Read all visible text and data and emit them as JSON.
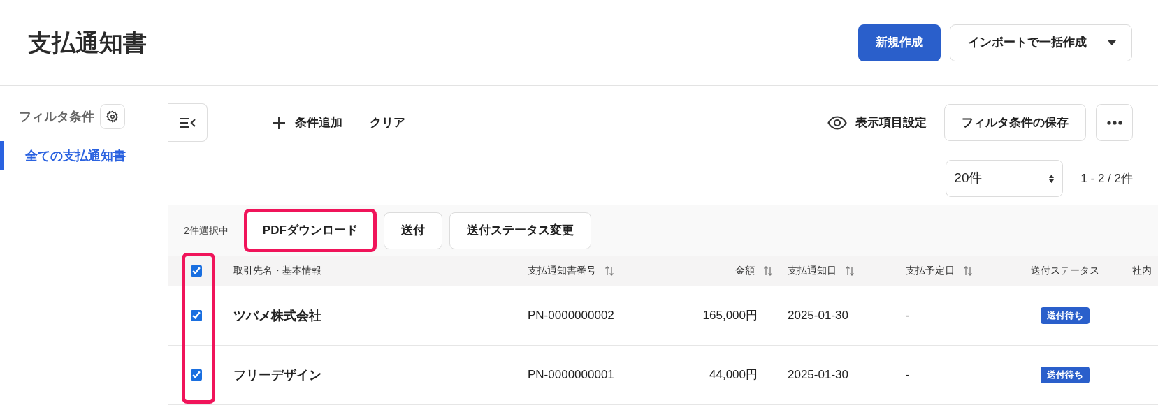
{
  "page": {
    "title": "支払通知書"
  },
  "header_actions": [
    {
      "kind": "primary",
      "label": "新規作成"
    },
    {
      "kind": "dropdown",
      "label": "インポートで一括作成"
    }
  ],
  "sidebar": {
    "heading": "フィルタ条件",
    "items": [
      {
        "label": "全ての支払通知書",
        "selected": true
      }
    ]
  },
  "toolbar": {
    "add_condition": "条件追加",
    "clear": "クリア",
    "display_settings": "表示項目設定",
    "save_filter": "フィルタ条件の保存"
  },
  "pagination": {
    "per_page": "20件",
    "range": "1 - 2 / 2件"
  },
  "bulk_bar": {
    "selected_count": "2件選択中",
    "actions": [
      {
        "label": "PDFダウンロード",
        "highlighted": true
      },
      {
        "label": "送付",
        "highlighted": false
      },
      {
        "label": "送付ステータス変更",
        "highlighted": false
      }
    ]
  },
  "table": {
    "all_checked": true,
    "checkbox_column_highlighted": true,
    "columns": [
      {
        "label": "取引先名・基本情報",
        "sortable": false
      },
      {
        "label": "支払通知書番号",
        "sortable": true
      },
      {
        "label": "金額",
        "sortable": true
      },
      {
        "label": "支払通知日",
        "sortable": true
      },
      {
        "label": "支払予定日",
        "sortable": true
      },
      {
        "label": "送付ステータス",
        "sortable": false
      },
      {
        "label": "社内",
        "sortable": false
      }
    ],
    "rows": [
      {
        "checked": true,
        "partner": "ツバメ株式会社",
        "number": "PN-0000000002",
        "amount": "165,000円",
        "notice_date": "2025-01-30",
        "scheduled_date": "-",
        "status": "送付待ち"
      },
      {
        "checked": true,
        "partner": "フリーデザイン",
        "number": "PN-0000000001",
        "amount": "44,000円",
        "notice_date": "2025-01-30",
        "scheduled_date": "-",
        "status": "送付待ち"
      }
    ]
  }
}
